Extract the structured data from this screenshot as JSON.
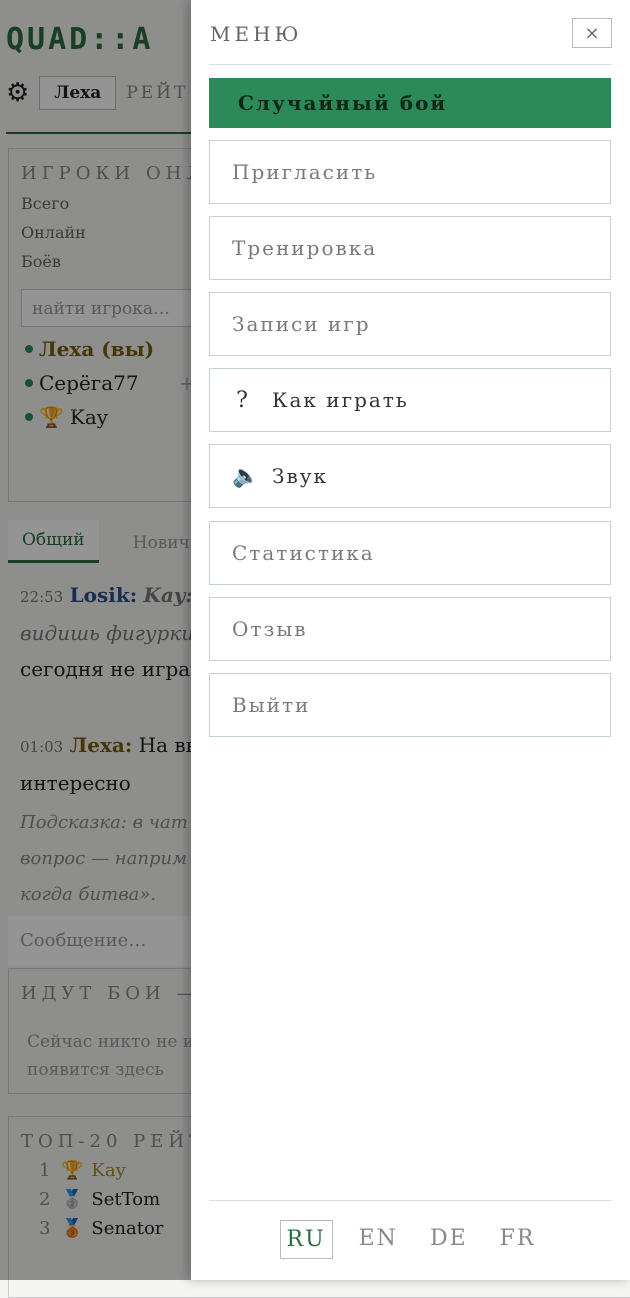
{
  "app": {
    "logo": "QUAD::A",
    "user_button": "Леха",
    "rating_link": "РЕЙТ",
    "online_panel": {
      "title": "ИГРОКИ ОНЛ",
      "stats": [
        "Всего",
        "Онлайн",
        "Боёв"
      ],
      "search_placeholder": "найти игрока…",
      "players": [
        "Леха (вы)",
        "Серёга77",
        "Kay"
      ],
      "player_extra": "+"
    },
    "chat": {
      "tabs": [
        "Общий",
        "Нович"
      ],
      "messages": [
        {
          "time": "22:53",
          "author": "Losik:",
          "quote": "Kay:",
          "text_italic": "видишь фигурки",
          "text_tail": ":",
          "text": "сегодня не играю"
        },
        {
          "time": "01:03",
          "author": "Леха:",
          "text": "На вы",
          "text2": "интересно"
        }
      ],
      "hint_lines": [
        "Подсказка: в чат",
        "вопрос — наприм",
        "когда битва»."
      ],
      "input_placeholder": "Сообщение…"
    },
    "battles": {
      "title": "ИДУТ БОИ —",
      "empty_lines": [
        "Сейчас никто не и",
        "появится здесь"
      ]
    },
    "top20": {
      "title": "ТОП-20 РЕЙТ",
      "rows": [
        {
          "n": "1",
          "name": "Kay",
          "icon": "🏆"
        },
        {
          "n": "2",
          "name": "SetTom",
          "icon": "🥈"
        },
        {
          "n": "3",
          "name": "Senator",
          "icon": "🥉"
        }
      ]
    }
  },
  "drawer": {
    "title": "МЕНЮ",
    "close_label": "×",
    "primary": "Случайный бой",
    "items": [
      "Пригласить",
      "Тренировка",
      "Записи игр",
      "Как играть",
      "Звук",
      "Статистика",
      "Отзыв",
      "Выйти"
    ],
    "help_icon": "?",
    "sound_icon": "🔈",
    "languages": [
      "RU",
      "EN",
      "DE",
      "FR"
    ],
    "active_language": "RU"
  },
  "colors": {
    "accent": "#2b8a57",
    "primary_text": "#0c2818"
  }
}
